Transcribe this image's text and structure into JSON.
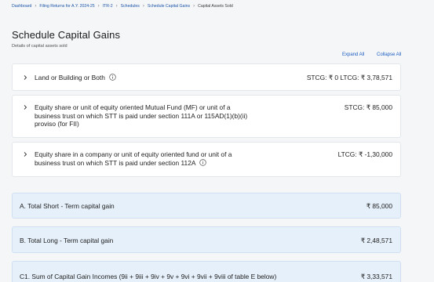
{
  "breadcrumb": {
    "items": [
      "Dashboard",
      "Filing Returns for A.Y. 2024-25",
      "ITR-2",
      "Schedules",
      "Schedule Capital Gains",
      "Capital Assets Sold"
    ]
  },
  "page": {
    "title": "Schedule Capital Gains",
    "subtitle": "Details of capital assets sold"
  },
  "toolbar": {
    "expand_all": "Expand All",
    "collapse_all": "Collapse All"
  },
  "sections": [
    {
      "line1": "Land or Building or Both",
      "line2": "",
      "line3": "",
      "line4": "",
      "amount": "STCG: ₹ 0   LTCG: ₹ 3,78,571"
    },
    {
      "line1": "Equity share or unit of equity oriented Mutual Fund (MF) or unit of a",
      "line2": "business trust on which STT is paid under section 111A or 115AD(1)(b)(ii)",
      "line3": "proviso (for FII)",
      "amount": "STCG: ₹ 85,000"
    },
    {
      "line1": "Equity share in a company or unit of equity oriented fund or unit of a",
      "line2": "business trust on which STT is paid under section 112A",
      "amount": "LTCG: ₹ -1,30,000"
    }
  ],
  "summary": [
    {
      "label": "A. Total Short - Term capital gain",
      "value": "₹ 85,000"
    },
    {
      "label": "B. Total Long - Term capital gain",
      "value": "₹ 2,48,571"
    },
    {
      "label": "C1. Sum of Capital Gain Incomes (9ii + 9iii + 9iv + 9v + 9vi + 9vii + 9viii of table E below)",
      "value": "₹ 3,33,571"
    }
  ],
  "icons": {
    "chevron": "chevron-right-icon",
    "info": "info-icon"
  },
  "colors": {
    "link": "#1a5cc0",
    "summary_bg": "#e6f0fa",
    "page_bg": "#f5f6f8"
  }
}
